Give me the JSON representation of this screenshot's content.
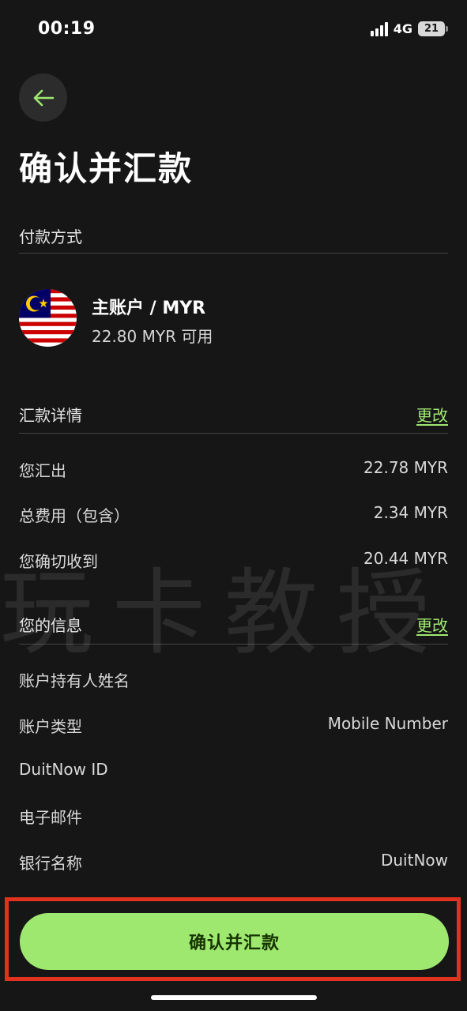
{
  "status_bar": {
    "time": "00:19",
    "network": "4G",
    "battery": "21"
  },
  "header": {
    "back_icon": "arrow-left-icon",
    "title": "确认并汇款"
  },
  "payment_method": {
    "section_title": "付款方式",
    "account_name": "主账户 / MYR",
    "balance": "22.80 MYR 可用",
    "flag_icon": "malaysia-flag-icon"
  },
  "transfer_details": {
    "section_title": "汇款详情",
    "change_label": "更改",
    "rows": [
      {
        "label": "您汇出",
        "value": "22.78 MYR"
      },
      {
        "label": "总费用（包含）",
        "value": "2.34 MYR"
      },
      {
        "label": "您确切收到",
        "value": "20.44 MYR"
      }
    ]
  },
  "your_info": {
    "section_title": "您的信息",
    "change_label": "更改",
    "rows": [
      {
        "label": "账户持有人姓名",
        "value": ""
      },
      {
        "label": "账户类型",
        "value": "Mobile Number"
      },
      {
        "label": "DuitNow ID",
        "value": ""
      },
      {
        "label": "电子邮件",
        "value": ""
      },
      {
        "label": "银行名称",
        "value": "DuitNow"
      }
    ]
  },
  "watermark": "玩卡教授",
  "footer": {
    "confirm_label": "确认并汇款"
  },
  "colors": {
    "accent": "#9fe870",
    "accent_text": "#163300",
    "background": "#161616",
    "highlight_border": "#e0321e"
  }
}
